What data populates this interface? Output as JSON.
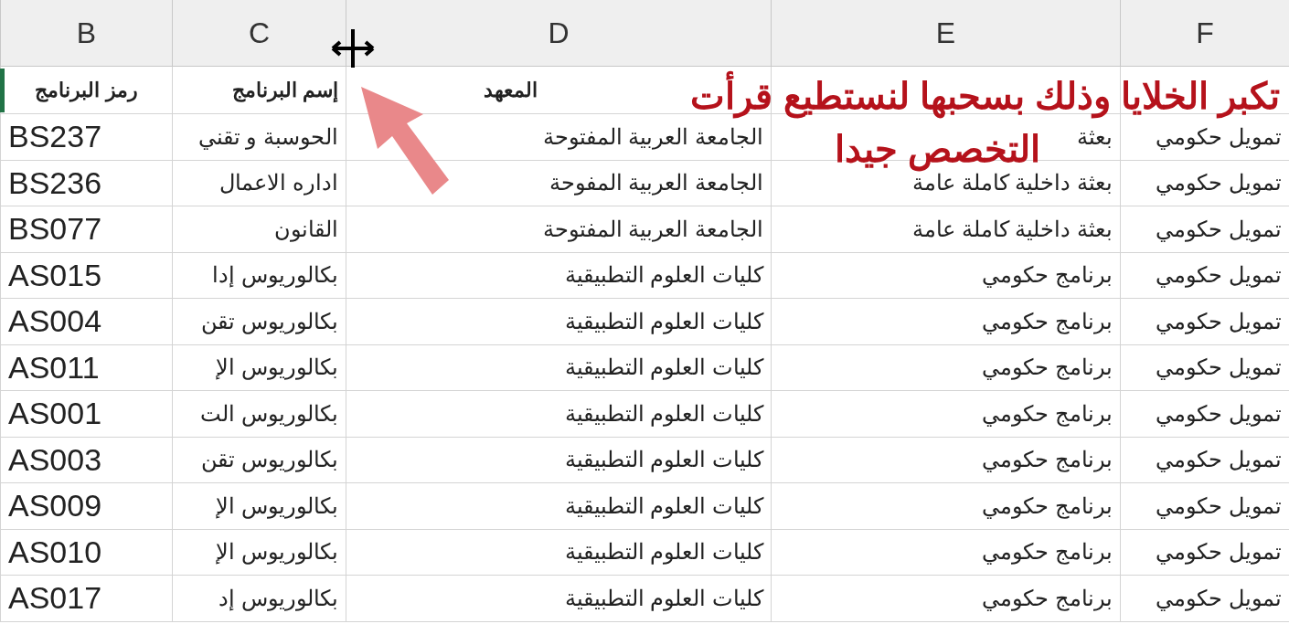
{
  "column_headers": [
    {
      "label": "F"
    },
    {
      "label": "E"
    },
    {
      "label": "D"
    },
    {
      "label": "C"
    },
    {
      "label": "B"
    }
  ],
  "header_row": [
    "المعهد",
    "إسم البرنامج",
    "رمز البرنامج"
  ],
  "rows": [
    [
      "تمويل حكومي",
      "بعثة",
      "الجامعة العربية المفتوحة",
      "الحوسبة و تقني",
      "BS237"
    ],
    [
      "تمويل حكومي",
      "بعثة داخلية كاملة عامة",
      "الجامعة العربية المفوحة",
      "اداره الاعمال",
      "BS236"
    ],
    [
      "تمويل حكومي",
      "بعثة داخلية كاملة عامة",
      "الجامعة العربية المفتوحة",
      "القانون",
      "BS077"
    ],
    [
      "تمويل حكومي",
      "برنامج حكومي",
      "كليات العلوم التطبيقية",
      "بكالوريوس إدا",
      "AS015"
    ],
    [
      "تمويل حكومي",
      "برنامج حكومي",
      "كليات العلوم التطبيقية",
      "بكالوريوس تقن",
      "AS004"
    ],
    [
      "تمويل حكومي",
      "برنامج حكومي",
      "كليات العلوم التطبيقية",
      "بكالوريوس الإ",
      "AS011"
    ],
    [
      "تمويل حكومي",
      "برنامج حكومي",
      "كليات العلوم التطبيقية",
      "بكالوريوس الت",
      "AS001"
    ],
    [
      "تمويل حكومي",
      "برنامج حكومي",
      "كليات العلوم التطبيقية",
      "بكالوريوس تقن",
      "AS003"
    ],
    [
      "تمويل حكومي",
      "برنامج حكومي",
      "كليات العلوم التطبيقية",
      "بكالوريوس الإ",
      "AS009"
    ],
    [
      "تمويل حكومي",
      "برنامج حكومي",
      "كليات العلوم التطبيقية",
      "بكالوريوس الإ",
      "AS010"
    ],
    [
      "تمويل حكومي",
      "برنامج حكومي",
      "كليات العلوم التطبيقية",
      "بكالوريوس إد",
      "AS017"
    ]
  ],
  "annotation": {
    "lines": [
      "تكبر الخلايا وذلك بسحبها لنستطيع قرأت",
      "التخصص جيدا"
    ]
  }
}
